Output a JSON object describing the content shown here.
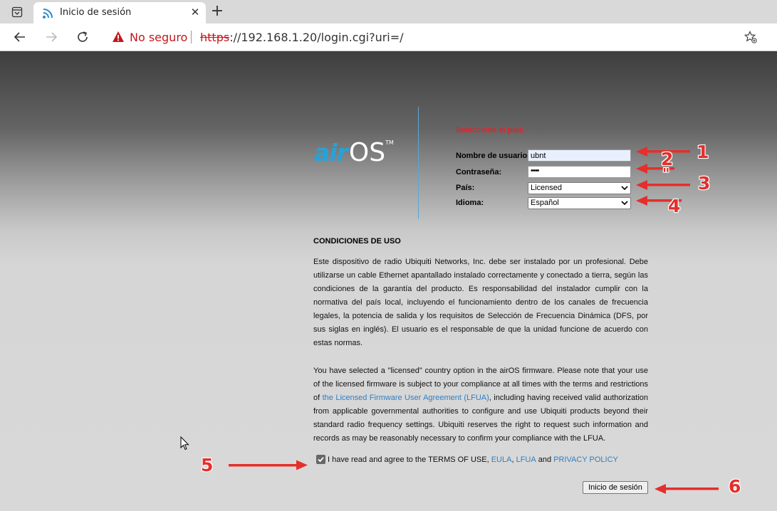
{
  "browser": {
    "tab_title": "Inicio de sesión",
    "security_label": "No seguro",
    "url_scheme": "https",
    "url_rest": "://192.168.1.20/login.cgi?uri=/",
    "url_host": "192.168.1.20",
    "close_glyph": "✕",
    "new_tab_glyph": "+"
  },
  "login": {
    "logo_air": "air",
    "logo_os": "OS",
    "logo_tm": "TM",
    "error_text": "Seleccione el país.",
    "username_label": "Nombre de usuario:",
    "username_value": "ubnt",
    "password_label": "Contraseña:",
    "password_value": "••••",
    "country_label": "País:",
    "country_value": "Licensed",
    "language_label": "Idioma:",
    "language_value": "Español"
  },
  "terms": {
    "heading": "CONDICIONES DE USO",
    "paragraph1": "Este dispositivo de radio Ubiquiti Networks, Inc. debe ser instalado por un profesional. Debe utilizarse un cable Ethernet apantallado instalado correctamente y conectado a tierra, según las condiciones de la garantía del producto. Es responsabilidad del instalador cumplir con la normativa del país local, incluyendo el funcionamiento dentro de los canales de frecuencia legales, la potencia de salida y los requisitos de Selección de Frecuencia Dinámica (DFS, por sus siglas en inglés). El usuario es el responsable de que la unidad funcione de acuerdo con estas normas.",
    "paragraph2_a": "You have selected a \"licensed\" country option in the airOS firmware. Please note that your use of the licensed firmware is subject to your compliance at all times with the terms and restrictions of ",
    "paragraph2_link": "the Licensed Firmware User Agreement (LFUA)",
    "paragraph2_b": ", including having received valid authorization from applicable governmental authorities to configure and use Ubiquiti products beyond their standard radio frequency settings. Ubiquiti reserves the right to request such information and records as may be reasonably necessary to confirm your compliance with the LFUA.",
    "agree_text": "I have read and agree to the TERMS OF USE,",
    "eula_link": "EULA",
    "lfua_link": "LFUA",
    "and_text": "and",
    "privacy_link": "PRIVACY POLICY",
    "agree_checked": true,
    "login_button": "Inicio de sesión"
  },
  "annotations": {
    "n1": "1",
    "n2": "2",
    "n2b": "\"",
    "n3": "3",
    "n4": "4",
    "n5": "5",
    "n6": "6",
    "color": "#e42f2b"
  },
  "colors": {
    "accent_blue": "#27a2d8",
    "error_red": "#e0242c",
    "link_blue": "#2f7fc2"
  }
}
